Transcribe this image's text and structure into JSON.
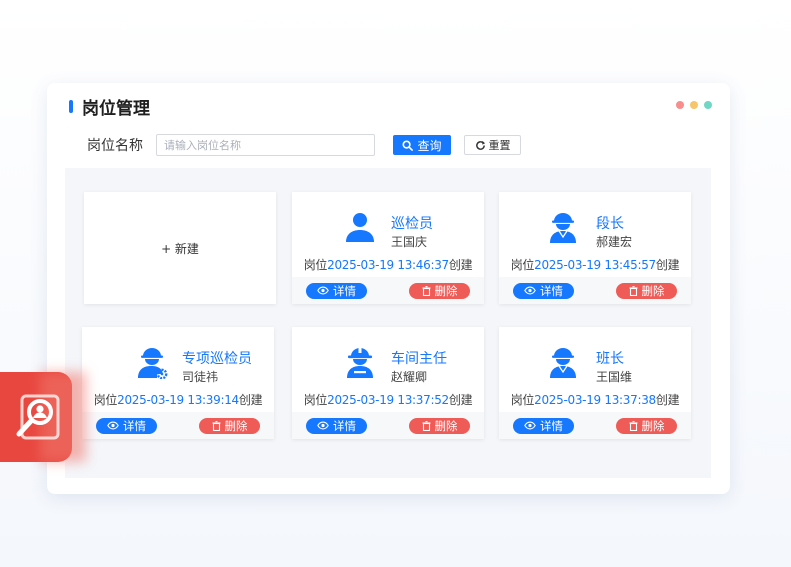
{
  "header": {
    "title": "岗位管理"
  },
  "window_dots": [
    "#f98d8b",
    "#f7c66a",
    "#6fd7c4"
  ],
  "filter": {
    "label": "岗位名称",
    "placeholder": "请输入岗位名称",
    "query_label": "查询",
    "reset_label": "重置"
  },
  "add_card": {
    "label": "+ 新建"
  },
  "positions": [
    {
      "name": "巡检员",
      "person": "王国庆",
      "created_prefix": "岗位",
      "created_date": "2025-03-19 13:46:37",
      "created_suffix": "创建",
      "icon": "worker-icon"
    },
    {
      "name": "段长",
      "person": "郝建宏",
      "created_prefix": "岗位",
      "created_date": "2025-03-19 13:45:57",
      "created_suffix": "创建",
      "icon": "hardhat-worker-icon"
    },
    {
      "name": "专项巡检员",
      "person": "司徒祎",
      "created_prefix": "岗位",
      "created_date": "2025-03-19 13:39:14",
      "created_suffix": "创建",
      "icon": "engineer-gear-icon"
    },
    {
      "name": "车间主任",
      "person": "赵耀卿",
      "created_prefix": "岗位",
      "created_date": "2025-03-19 13:37:52",
      "created_suffix": "创建",
      "icon": "construction-worker-icon"
    },
    {
      "name": "班长",
      "person": "王国维",
      "created_prefix": "岗位",
      "created_date": "2025-03-19 13:37:38",
      "created_suffix": "创建",
      "icon": "hardhat-worker-icon"
    }
  ],
  "actions": {
    "detail_label": "详情",
    "delete_label": "删除"
  },
  "colors": {
    "primary": "#1677ff",
    "danger": "#ef5b57",
    "float_tile": "#e8473f"
  }
}
